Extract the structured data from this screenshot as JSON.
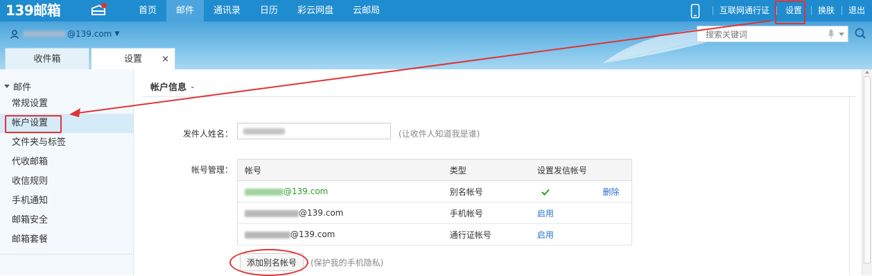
{
  "brand": {
    "logo_text": "139邮箱",
    "accent": "#1f8ccf",
    "annotation_color": "#e03333"
  },
  "topnav": {
    "items": [
      {
        "label": "首页"
      },
      {
        "label": "邮件",
        "active": true
      },
      {
        "label": "通讯录"
      },
      {
        "label": "日历"
      },
      {
        "label": "彩云网盘"
      },
      {
        "label": "云邮局"
      }
    ],
    "right_links": [
      {
        "label": "互联网通行证"
      },
      {
        "label": "设置",
        "highlighted": true
      },
      {
        "label": "换肤"
      },
      {
        "label": "退出"
      }
    ]
  },
  "header": {
    "user_email_suffix": "@139.com",
    "search_placeholder": "搜索关键词",
    "tabs": [
      {
        "label": "收件箱"
      },
      {
        "label": "设置",
        "active": true,
        "close": "×"
      }
    ]
  },
  "sidebar": {
    "section": "邮件",
    "items": [
      {
        "label": "常规设置"
      },
      {
        "label": "帐户设置",
        "active": true,
        "highlighted": true
      },
      {
        "label": "文件夹与标签"
      },
      {
        "label": "代收邮箱"
      },
      {
        "label": "收信规则"
      },
      {
        "label": "手机通知"
      },
      {
        "label": "邮箱安全"
      },
      {
        "label": "邮箱套餐"
      }
    ]
  },
  "main": {
    "section_title": "帐户信息",
    "sender_name_label": "发件人姓名：",
    "sender_name_hint": "(让收件人知道我是谁)",
    "account_mgmt_label": "帐号管理：",
    "table": {
      "headers": [
        "帐号",
        "类型",
        "设置发信帐号"
      ],
      "rows": [
        {
          "account_suffix": "@139.com",
          "type": "别名帐号",
          "is_sender": true,
          "action": "删除"
        },
        {
          "account_suffix": "@139.com",
          "type": "手机帐号",
          "is_sender": false,
          "action": "启用"
        },
        {
          "account_suffix": "@139.com",
          "type": "通行证帐号",
          "is_sender": false,
          "action": "启用"
        }
      ]
    },
    "add_alias_button": "添加别名帐号",
    "add_alias_hint": "(保护我的手机隐私)"
  }
}
